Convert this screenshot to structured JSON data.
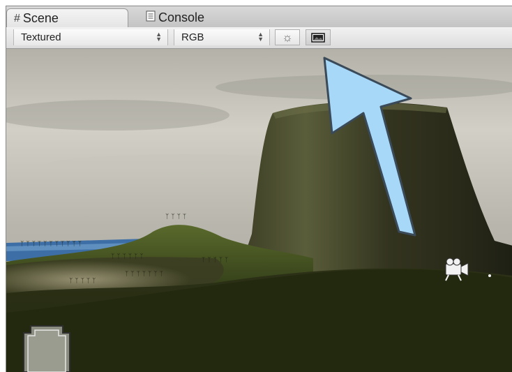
{
  "tabs": [
    {
      "label": "Scene",
      "icon": "grid-icon",
      "active": true
    },
    {
      "label": "Console",
      "icon": "console-icon",
      "active": false
    }
  ],
  "toolbar": {
    "render_mode": "Textured",
    "color_channel": "RGB",
    "buttons": [
      {
        "icon": "sun-lighting-icon",
        "pressed": false
      },
      {
        "icon": "image-icon",
        "pressed": true
      }
    ]
  },
  "scene": {
    "objects": [
      "sky",
      "sea",
      "volcano-mountain",
      "hills",
      "palm-trees",
      "camera-gizmo-icon",
      "light-gizmo-icon"
    ],
    "callout_arrow_color": "#a8d8f8"
  }
}
